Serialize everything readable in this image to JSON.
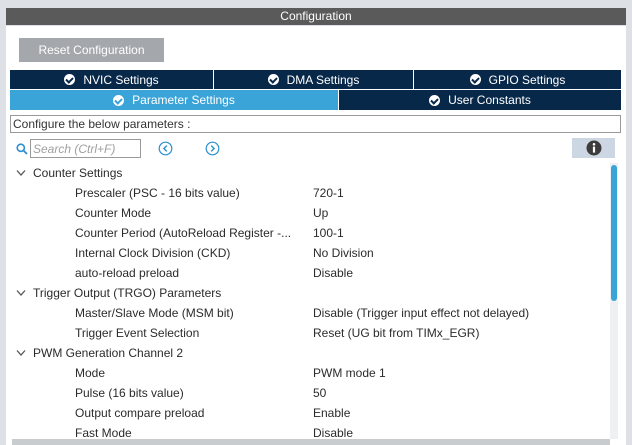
{
  "window": {
    "title": "Configuration"
  },
  "toolbar": {
    "reset_label": "Reset Configuration"
  },
  "tabs_row1": [
    {
      "label": "NVIC Settings"
    },
    {
      "label": "DMA Settings"
    },
    {
      "label": "GPIO Settings"
    }
  ],
  "tabs_row2": [
    {
      "label": "Parameter Settings",
      "active": true
    },
    {
      "label": "User Constants",
      "active": false
    }
  ],
  "configure_text": "Configure the below parameters :",
  "search": {
    "placeholder": "Search (Ctrl+F)",
    "value": ""
  },
  "icons": {
    "search": "search-icon",
    "prev": "chevron-left-circle-icon",
    "next": "chevron-right-circle-icon",
    "info": "info-icon",
    "expand": "chevron-down-icon",
    "check": "check-circle-icon"
  },
  "colors": {
    "tab_dark": "#08284a",
    "tab_active": "#3aa3d8",
    "title_bar": "#5a5a5a",
    "button": "#a4a7ab",
    "scrollbar": "#3aa3d8"
  },
  "groups": [
    {
      "label": "Counter Settings",
      "params": [
        {
          "name": "Prescaler (PSC - 16 bits value)",
          "value": "720-1"
        },
        {
          "name": "Counter Mode",
          "value": "Up"
        },
        {
          "name": "Counter Period (AutoReload Register -...",
          "value": "100-1"
        },
        {
          "name": "Internal Clock Division (CKD)",
          "value": "No Division"
        },
        {
          "name": "auto-reload preload",
          "value": "Disable"
        }
      ]
    },
    {
      "label": "Trigger Output (TRGO) Parameters",
      "params": [
        {
          "name": "Master/Slave Mode (MSM bit)",
          "value": "Disable (Trigger input effect not delayed)"
        },
        {
          "name": "Trigger Event Selection",
          "value": "Reset (UG bit from TIMx_EGR)"
        }
      ]
    },
    {
      "label": "PWM Generation Channel 2",
      "params": [
        {
          "name": "Mode",
          "value": "PWM mode 1"
        },
        {
          "name": "Pulse (16 bits value)",
          "value": "50"
        },
        {
          "name": "Output compare preload",
          "value": "Enable"
        },
        {
          "name": "Fast Mode",
          "value": "Disable"
        }
      ]
    }
  ]
}
